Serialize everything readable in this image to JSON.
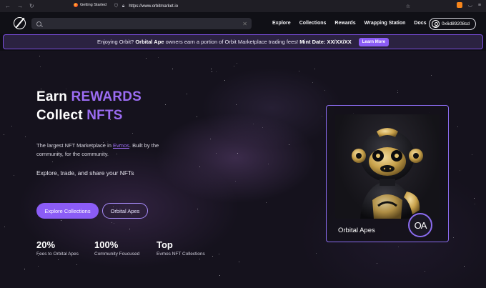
{
  "browser": {
    "bookmark": "Getting Started",
    "url": "https://www.orbitmarket.io"
  },
  "header": {
    "search": {
      "value": "",
      "placeholder": ""
    },
    "nav": [
      "Explore",
      "Collections",
      "Rewards",
      "Wrapping Station",
      "Docs"
    ],
    "wallet": "0x6d89208cd"
  },
  "announcement": {
    "pre": "Enjoying Orbit?",
    "bold1": "Orbital Ape",
    "mid": "owners earn a portion of Orbit Marketplace trading fees!",
    "bold2": "Mint Date: XX/XX/XX",
    "button": "Learn More"
  },
  "hero": {
    "line1_a": "Earn",
    "line1_b": "REWARDS",
    "line2_a": "Collect",
    "line2_b": "NFTS",
    "desc_a": "The largest NFT Marketplace in",
    "desc_link": "Evmos",
    "desc_b": ". Built by the community, for the community.",
    "sub": "Explore, trade, and share your NFTs",
    "btn_primary": "Explore Collections",
    "btn_secondary": "Orbital Apes",
    "stats": [
      {
        "value": "20%",
        "label": "Fees to Orbital Apes"
      },
      {
        "value": "100%",
        "label": "Community Foucused"
      },
      {
        "value": "Top",
        "label": "Evmos NFT Collections"
      }
    ]
  },
  "card": {
    "title": "Orbital Apes",
    "badge": "OA"
  },
  "colors": {
    "accent": "#8b5cf6",
    "accent_text": "#9b6cf2",
    "announce_bg": "#2b2241"
  }
}
